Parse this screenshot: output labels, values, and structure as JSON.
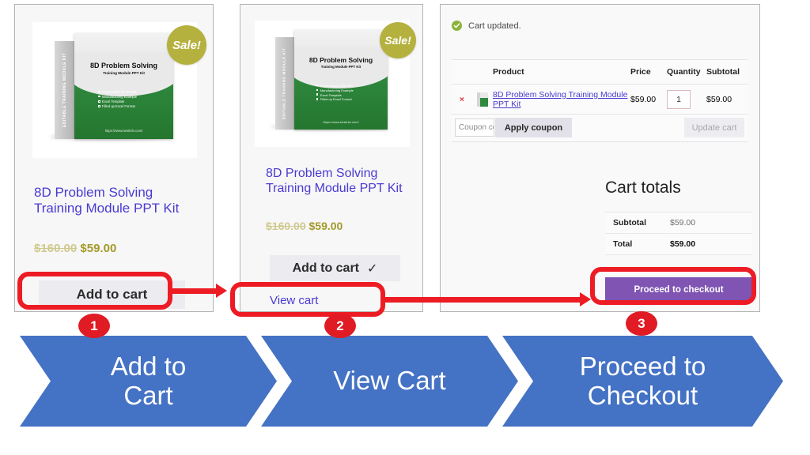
{
  "product": {
    "title": "8D Problem Solving Training Module PPT Kit",
    "price_old": "$160.00",
    "price_new": "$59.00",
    "sale_badge": "Sale!",
    "box": {
      "side_label": "EDITABLE TRAINING MODULE KIT",
      "title": "8D Problem Solving",
      "subtitle": "Training Module PPT Kit",
      "bullets": [
        "Presentation of 8D with",
        "Manufacturing Example",
        "Excel Template",
        "Filled up Excel Format"
      ],
      "url": "https://www.bestinfo.com/"
    }
  },
  "panel1": {
    "add_to_cart_label": "Add to cart"
  },
  "panel2": {
    "add_to_cart_label": "Add to cart",
    "added_check": "✓",
    "view_cart_label": "View cart"
  },
  "cart": {
    "notice": "Cart updated.",
    "notice_icon": "check-circle-icon",
    "columns": [
      "",
      "",
      "Product",
      "Price",
      "Quantity",
      "Subtotal"
    ],
    "rows": [
      {
        "remove": "×",
        "thumb": "product-thumbnail",
        "product": "8D Problem Solving Training Module PPT Kit",
        "price": "$59.00",
        "quantity": "1",
        "subtotal": "$59.00"
      }
    ],
    "coupon_placeholder": "Coupon code",
    "apply_coupon_label": "Apply coupon",
    "update_cart_label": "Update cart",
    "totals_title": "Cart totals",
    "totals": [
      {
        "label": "Subtotal",
        "value": "$59.00"
      },
      {
        "label": "Total",
        "value": "$59.00"
      }
    ],
    "checkout_label": "Proceed to checkout"
  },
  "steps": [
    {
      "number": "1",
      "line1": "Add to",
      "line2": "Cart"
    },
    {
      "number": "2",
      "line1": "View Cart",
      "line2": ""
    },
    {
      "number": "3",
      "line1": "Proceed to",
      "line2": "Checkout"
    }
  ],
  "colors": {
    "annotation_red": "#ed1c24",
    "chevron_blue": "#4472c4",
    "checkout_purple": "#7f54b3",
    "link_purple": "#4a3ad1",
    "sale_olive": "#b5b13f",
    "notice_green": "#8bb33b"
  }
}
